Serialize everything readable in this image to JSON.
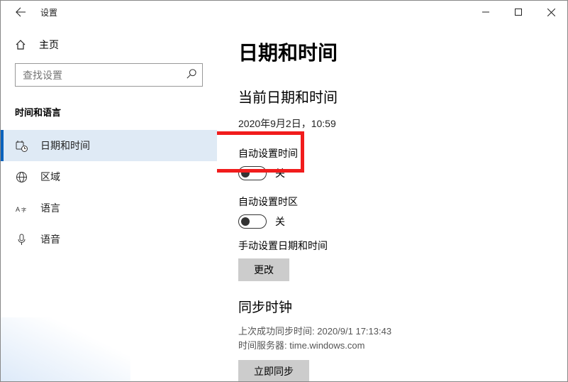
{
  "window": {
    "title": "设置"
  },
  "sidebar": {
    "home": "主页",
    "search_placeholder": "查找设置",
    "group": "时间和语言",
    "items": [
      {
        "label": "日期和时间"
      },
      {
        "label": "区域"
      },
      {
        "label": "语言"
      },
      {
        "label": "语音"
      }
    ]
  },
  "main": {
    "title": "日期和时间",
    "current_label": "当前日期和时间",
    "current_value": "2020年9月2日，10:59",
    "auto_time_label": "自动设置时间",
    "auto_time_state": "关",
    "auto_tz_label": "自动设置时区",
    "auto_tz_state": "关",
    "manual_label": "手动设置日期和时间",
    "change_btn": "更改",
    "sync_heading": "同步时钟",
    "sync_last_label": "上次成功同步时间:",
    "sync_last_value": "2020/9/1 17:13:43",
    "sync_server_label": "时间服务器:",
    "sync_server_value": "time.windows.com",
    "sync_btn": "立即同步"
  }
}
